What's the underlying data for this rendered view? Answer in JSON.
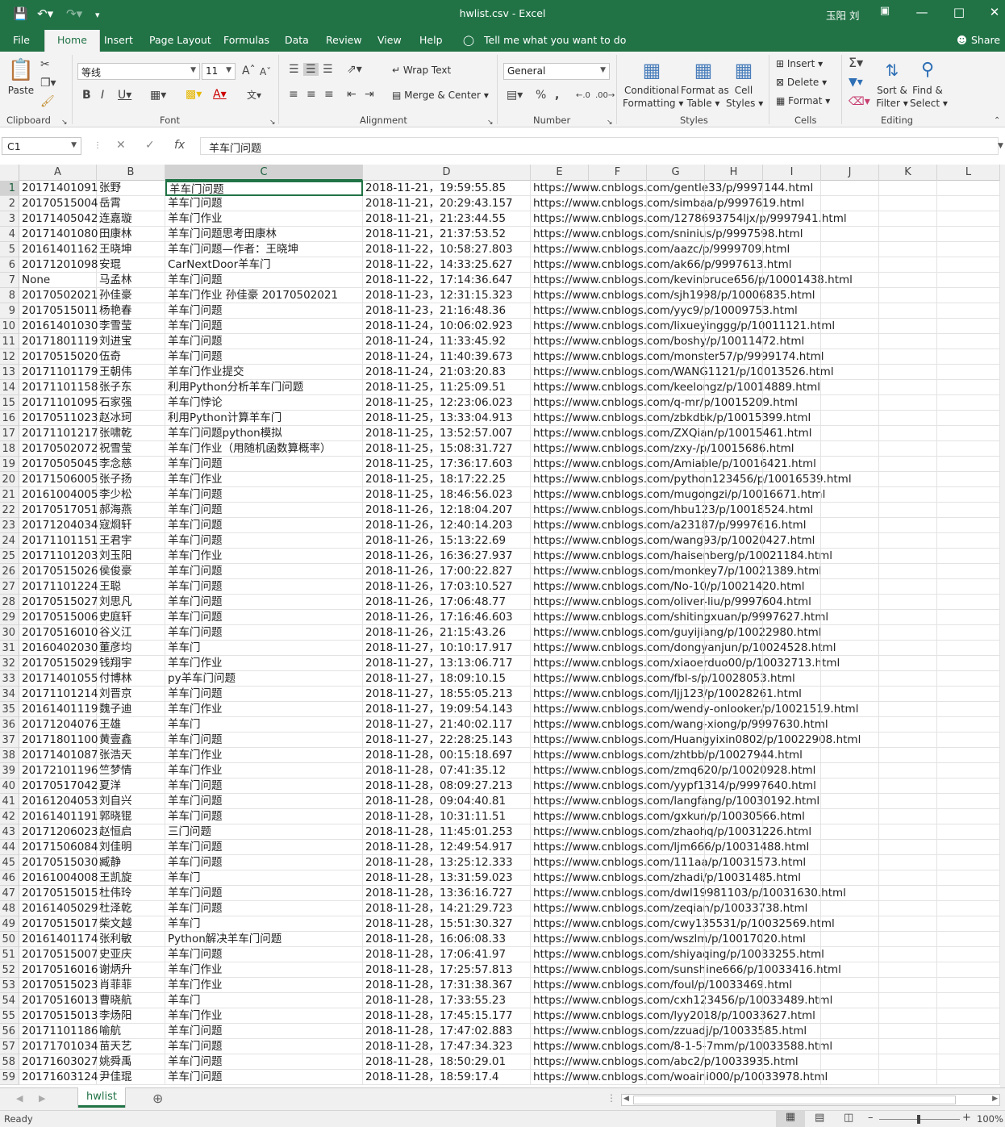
{
  "window": {
    "title": "hwlist.csv  -  Excel",
    "user": "玉阳 刘"
  },
  "colors": {
    "accent": "#217346"
  },
  "tabs": [
    "File",
    "Home",
    "Insert",
    "Page Layout",
    "Formulas",
    "Data",
    "Review",
    "View",
    "Help"
  ],
  "tell_me": "Tell me what you want to do",
  "share": "Share",
  "ribbon": {
    "clipboard": {
      "paste": "Paste",
      "label": "Clipboard"
    },
    "font": {
      "name": "等线",
      "size": "11",
      "label": "Font"
    },
    "alignment": {
      "wrap": "Wrap Text",
      "merge": "Merge & Center",
      "label": "Alignment"
    },
    "number": {
      "format": "General",
      "label": "Number"
    },
    "styles": {
      "conditional": [
        "Conditional",
        "Formatting"
      ],
      "format_table": [
        "Format as",
        "Table"
      ],
      "cell_styles": [
        "Cell",
        "Styles"
      ],
      "label": "Styles"
    },
    "cells": {
      "insert": "Insert",
      "delete": "Delete",
      "format": "Format",
      "label": "Cells"
    },
    "editing": {
      "sort": [
        "Sort &",
        "Filter"
      ],
      "find": [
        "Find &",
        "Select"
      ],
      "label": "Editing"
    }
  },
  "formula_bar": {
    "name_box": "C1",
    "value": "羊车门问题"
  },
  "columns": [
    "A",
    "B",
    "C",
    "D",
    "E",
    "F",
    "G",
    "H",
    "I",
    "J",
    "K",
    "L"
  ],
  "rows": [
    [
      "1",
      "20171401091",
      "张野",
      "羊车门问题",
      "2018-11-21，19:59:55.85",
      "https://www.cnblogs.com/gentle33/p/9997144.html"
    ],
    [
      "2",
      "20170515004",
      "岳霄",
      "羊车门问题",
      "2018-11-21，20:29:43.157",
      "https://www.cnblogs.com/simbaa/p/9997619.html"
    ],
    [
      "3",
      "20171405042",
      "连嘉璇",
      "羊车门作业",
      "2018-11-21，21:23:44.55",
      "https://www.cnblogs.com/1278693754ljx/p/9997941.html"
    ],
    [
      "4",
      "20171401080",
      "田康林",
      "羊车门问题思考田康林",
      "2018-11-21，21:37:53.52",
      "https://www.cnblogs.com/sninius/p/9997598.html"
    ],
    [
      "5",
      "20161401162",
      "王晓坤",
      "羊车门问题—作者：王晓坤",
      "2018-11-22，10:58:27.803",
      "https://www.cnblogs.com/aazc/p/9999709.html"
    ],
    [
      "6",
      "20171201098",
      "安琨",
      "CarNextDoor羊车门",
      "2018-11-22，14:33:25.627",
      "https://www.cnblogs.com/ak66/p/9997613.html"
    ],
    [
      "7",
      "None",
      "马孟林",
      "羊车门问题",
      "2018-11-22，17:14:36.647",
      "https://www.cnblogs.com/kevinbruce656/p/10001438.html"
    ],
    [
      "8",
      "20170502021",
      "孙佳豪",
      "羊车门作业 孙佳豪 20170502021",
      "2018-11-23，12:31:15.323",
      "https://www.cnblogs.com/sjh1998/p/10006835.html"
    ],
    [
      "9",
      "20170515011",
      "杨艳春",
      "羊车门问题",
      "2018-11-23，21:16:48.36",
      "https://www.cnblogs.com/yyc9/p/10009753.html"
    ],
    [
      "10",
      "20161401030",
      "李雪莹",
      "羊车门问题",
      "2018-11-24，10:06:02.923",
      "https://www.cnblogs.com/lixueyinggg/p/10011121.html"
    ],
    [
      "11",
      "20171801119",
      "刘进宝",
      "羊车门问题",
      "2018-11-24，11:33:45.92",
      "https://www.cnblogs.com/boshy/p/10011472.html"
    ],
    [
      "12",
      "20170515020",
      "伍奇",
      "羊车门问题",
      "2018-11-24，11:40:39.673",
      "https://www.cnblogs.com/monster57/p/9999174.html"
    ],
    [
      "13",
      "20171101179",
      "王朝伟",
      "羊车门作业提交",
      "2018-11-24，21:03:20.83",
      "https://www.cnblogs.com/WANG1121/p/10013526.html"
    ],
    [
      "14",
      "20171101158",
      "张子东",
      "利用Python分析羊车门问题",
      "2018-11-25，11:25:09.51",
      "https://www.cnblogs.com/keelongz/p/10014889.html"
    ],
    [
      "15",
      "20171101095",
      "石家强",
      "羊车门悖论",
      "2018-11-25，12:23:06.023",
      "https://www.cnblogs.com/q-mr/p/10015209.html"
    ],
    [
      "16",
      "20170511023",
      "赵冰珂",
      "利用Python计算羊车门",
      "2018-11-25，13:33:04.913",
      "https://www.cnblogs.com/zbkdbk/p/10015399.html"
    ],
    [
      "17",
      "20171101217",
      "张啸乾",
      "羊车门问题python模拟",
      "2018-11-25，13:52:57.007",
      "https://www.cnblogs.com/ZXQian/p/10015461.html"
    ],
    [
      "18",
      "20170502072",
      "祝雪莹",
      "羊车门作业（用随机函数算概率）",
      "2018-11-25，15:08:31.727",
      "https://www.cnblogs.com/zxy-/p/10015686.html"
    ],
    [
      "19",
      "20170505045",
      "李念慈",
      "羊车门问题",
      "2018-11-25，17:36:17.603",
      "https://www.cnblogs.com/Amiable/p/10016421.html"
    ],
    [
      "20",
      "20171506005",
      "张子扬",
      "羊车门作业",
      "2018-11-25，18:17:22.25",
      "https://www.cnblogs.com/python123456/p/10016539.html"
    ],
    [
      "21",
      "20161004005",
      "李少松",
      "羊车门问题",
      "2018-11-25，18:46:56.023",
      "https://www.cnblogs.com/mugongzi/p/10016671.html"
    ],
    [
      "22",
      "20170517051",
      "郝海燕",
      "羊车门问题",
      "2018-11-26，12:18:04.207",
      "https://www.cnblogs.com/hbu123/p/10018524.html"
    ],
    [
      "23",
      "20171204034",
      "寇烱轩",
      "羊车门问题",
      "2018-11-26，12:40:14.203",
      "https://www.cnblogs.com/a23187/p/9997616.html"
    ],
    [
      "24",
      "20171101151",
      "王君宇",
      "羊车门问题",
      "2018-11-26，15:13:22.69",
      "https://www.cnblogs.com/wang93/p/10020427.html"
    ],
    [
      "25",
      "20171101203",
      "刘玉阳",
      "羊车门作业",
      "2018-11-26，16:36:27.937",
      "https://www.cnblogs.com/haisenberg/p/10021184.html"
    ],
    [
      "26",
      "20170515026",
      "侯俊豪",
      "羊车门问题",
      "2018-11-26，17:00:22.827",
      "https://www.cnblogs.com/monkey7/p/10021389.html"
    ],
    [
      "27",
      "20171101224",
      "王聪",
      "羊车门问题",
      "2018-11-26，17:03:10.527",
      "https://www.cnblogs.com/No-10/p/10021420.html"
    ],
    [
      "28",
      "20170515027",
      "刘思凡",
      "羊车门问题",
      "2018-11-26，17:06:48.77",
      "https://www.cnblogs.com/oliver-liu/p/9997604.html"
    ],
    [
      "29",
      "20170515006",
      "史庭轩",
      "羊车门问题",
      "2018-11-26，17:16:46.603",
      "https://www.cnblogs.com/shitingxuan/p/9997627.html"
    ],
    [
      "30",
      "20170516010",
      "谷义江",
      "羊车门问题",
      "2018-11-26，21:15:43.26",
      "https://www.cnblogs.com/guyijiang/p/10022980.html"
    ],
    [
      "31",
      "20160402030",
      "董彦均",
      "羊车门",
      "2018-11-27，10:10:17.917",
      "https://www.cnblogs.com/dongyanjun/p/10024528.html"
    ],
    [
      "32",
      "20170515029",
      "钱翔宇",
      "羊车门作业",
      "2018-11-27，13:13:06.717",
      "https://www.cnblogs.com/xiaoerduo00/p/10032713.html"
    ],
    [
      "33",
      "20171401055",
      "付博林",
      "py羊车门问题",
      "2018-11-27，18:09:10.15",
      "https://www.cnblogs.com/fbl-s/p/10028053.html"
    ],
    [
      "34",
      "20171101214",
      "刘晋京",
      "羊车门问题",
      "2018-11-27，18:55:05.213",
      "https://www.cnblogs.com/ljj123/p/10028261.html"
    ],
    [
      "35",
      "20161401119",
      "魏子迪",
      "羊车门作业",
      "2018-11-27，19:09:54.143",
      "https://www.cnblogs.com/wendy-onlooker/p/10021519.html"
    ],
    [
      "36",
      "20171204076",
      "王雄",
      "羊车门",
      "2018-11-27，21:40:02.117",
      "https://www.cnblogs.com/wang-xiong/p/9997630.html"
    ],
    [
      "37",
      "20171801100",
      "黄壹鑫",
      "羊车门问题",
      "2018-11-27，22:28:25.143",
      "https://www.cnblogs.com/Huangyixin0802/p/10022908.html"
    ],
    [
      "38",
      "20171401087",
      "张浩天",
      "羊车门作业",
      "2018-11-28，00:15:18.697",
      "https://www.cnblogs.com/zhtbb/p/10027944.html"
    ],
    [
      "39",
      "20172101196",
      "竺梦情",
      "羊车门作业",
      "2018-11-28，07:41:35.12",
      "https://www.cnblogs.com/zmq620/p/10020928.html"
    ],
    [
      "40",
      "20170517042",
      "夏洋",
      "羊车门问题",
      "2018-11-28，08:09:27.213",
      "https://www.cnblogs.com/yypf1314/p/9997640.html"
    ],
    [
      "41",
      "20161204053",
      "刘自兴",
      "羊车门问题",
      "2018-11-28，09:04:40.81",
      "https://www.cnblogs.com/langfang/p/10030192.html"
    ],
    [
      "42",
      "20161401191",
      "郭晓锟",
      "羊车门问题",
      "2018-11-28，10:31:11.51",
      "https://www.cnblogs.com/gxkun/p/10030566.html"
    ],
    [
      "43",
      "20171206023",
      "赵恒启",
      "三门问题",
      "2018-11-28，11:45:01.253",
      "https://www.cnblogs.com/zhaohq/p/10031226.html"
    ],
    [
      "44",
      "20171506084",
      "刘佳明",
      "羊车门问题",
      "2018-11-28，12:49:54.917",
      "https://www.cnblogs.com/ljm666/p/10031488.html"
    ],
    [
      "45",
      "20170515030",
      "臧静",
      "羊车门问题",
      "2018-11-28，13:25:12.333",
      "https://www.cnblogs.com/111aa/p/10031573.html"
    ],
    [
      "46",
      "20161004008",
      "王凯旋",
      "羊车门",
      "2018-11-28，13:31:59.023",
      "https://www.cnblogs.com/zhadi/p/10031485.html"
    ],
    [
      "47",
      "20170515015",
      "杜伟玲",
      "羊车门问题",
      "2018-11-28，13:36:16.727",
      "https://www.cnblogs.com/dwl19981103/p/10031630.html"
    ],
    [
      "48",
      "20161405029",
      "杜泽乾",
      "羊车门问题",
      "2018-11-28，14:21:29.723",
      "https://www.cnblogs.com/zeqian/p/10033738.html"
    ],
    [
      "49",
      "20170515017",
      "柴文越",
      "羊车门",
      "2018-11-28，15:51:30.327",
      "https://www.cnblogs.com/cwy135531/p/10032569.html"
    ],
    [
      "50",
      "20161401174",
      "张利敏",
      "Python解决羊车门问题",
      "2018-11-28，16:06:08.33",
      "https://www.cnblogs.com/wszlm/p/10017020.html"
    ],
    [
      "51",
      "20170515007",
      "史亚庆",
      "羊车门问题",
      "2018-11-28，17:06:41.97",
      "https://www.cnblogs.com/shiyaqing/p/10033255.html"
    ],
    [
      "52",
      "20170516016",
      "谢炳升",
      "羊车门作业",
      "2018-11-28，17:25:57.813",
      "https://www.cnblogs.com/sunshine666/p/10033416.html"
    ],
    [
      "53",
      "20170515023",
      "肖菲菲",
      "羊车门作业",
      "2018-11-28，17:31:38.367",
      "https://www.cnblogs.com/foul/p/10033469.html"
    ],
    [
      "54",
      "20170516013",
      "曹晓航",
      "羊车门",
      "2018-11-28，17:33:55.23",
      "https://www.cnblogs.com/cxh123456/p/10033489.html"
    ],
    [
      "55",
      "20170515013",
      "李炀阳",
      "羊车门作业",
      "2018-11-28，17:45:15.177",
      "https://www.cnblogs.com/lyy2018/p/10033627.html"
    ],
    [
      "56",
      "20171101186",
      "喻航",
      "羊车门问题",
      "2018-11-28，17:47:02.883",
      "https://www.cnblogs.com/zzuadj/p/10033585.html"
    ],
    [
      "57",
      "20171701034",
      "苗天艺",
      "羊车门问题",
      "2018-11-28，17:47:34.323",
      "https://www.cnblogs.com/8-1-5-7mm/p/10033588.html"
    ],
    [
      "58",
      "20171603027",
      "姚舜禹",
      "羊车门问题",
      "2018-11-28，18:50:29.01",
      "https://www.cnblogs.com/abc2/p/10033935.html"
    ],
    [
      "59",
      "20171603124",
      "尹佳琨",
      "羊车门问题",
      "2018-11-28，18:59:17.4",
      "https://www.cnblogs.com/woaini000/p/10033978.html"
    ]
  ],
  "sheet": {
    "name": "hwlist"
  },
  "status": {
    "left": "Ready",
    "zoom": "100%"
  }
}
